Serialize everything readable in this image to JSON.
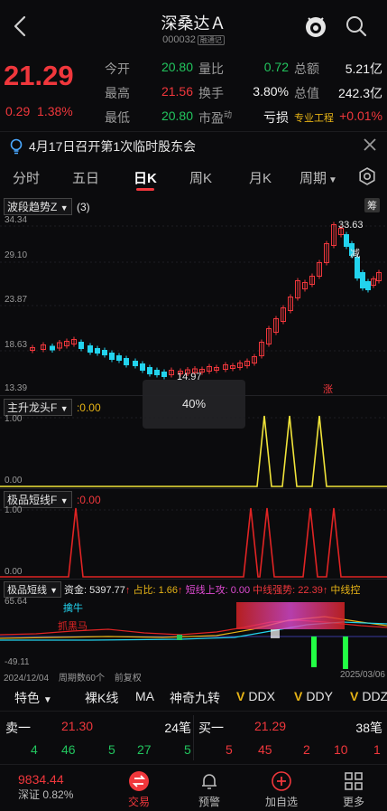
{
  "header": {
    "title": "深桑达Ａ",
    "code": "000032",
    "code_tag": "融通记"
  },
  "quote": {
    "price": "21.29",
    "change": "0.29",
    "change_pct": "1.38%",
    "fields": [
      {
        "label": "今开",
        "value": "20.80",
        "color": "green"
      },
      {
        "label": "量比",
        "value": "0.72",
        "color": "green"
      },
      {
        "label": "总额",
        "value": "5.21亿",
        "color": "white"
      },
      {
        "label": "最高",
        "value": "21.56",
        "color": "red"
      },
      {
        "label": "换手",
        "value": "3.80%",
        "color": "white"
      },
      {
        "label": "总值",
        "value": "242.3亿",
        "color": "white"
      },
      {
        "label": "最低",
        "value": "20.80",
        "color": "green"
      },
      {
        "label": "市盈",
        "value": "亏损",
        "color": "white",
        "label_sup": "动"
      },
      {
        "label": "专业工程",
        "value": "+0.01%",
        "color": "red"
      }
    ]
  },
  "notice": {
    "text": "4月17日召开第1次临时股东会"
  },
  "tabs": [
    "分时",
    "五日",
    "日K",
    "周K",
    "月K",
    "周期"
  ],
  "main_chart": {
    "indicator": "波段趋势Z",
    "param": "(3)",
    "chip_label": "筹",
    "y_labels": [
      "34.34",
      "29.10",
      "23.87",
      "18.63",
      "13.39"
    ],
    "high_label": "33.63",
    "low_label": "14.97",
    "overlay_pct": "40%",
    "mark_jian": "减",
    "mark_zhang": "涨"
  },
  "panel2": {
    "indicator": "主升龙头F",
    "value": ":0.00",
    "y_top": "1.00",
    "y_bottom": "0.00"
  },
  "panel3": {
    "indicator": "极品短线F",
    "value": ":0.00",
    "y_top": "1.00",
    "y_bottom": "0.00"
  },
  "panel4": {
    "indicator": "极品短线",
    "fund": "资金: 5397.77",
    "ratio": "占比: 1.66",
    "short_up": "短线上攻: 0.00",
    "mid_strength": "中线强势: 22.39",
    "mid_ctrl": "中线控",
    "y_top": "65.64",
    "y_bottom": "-49.11",
    "start_date": "2024/12/04",
    "period_count": "周期数60个",
    "adjust": "前复权",
    "end_date": "2025/03/06",
    "tag_qinniu": "擒牛",
    "tag_zhuahei": "抓黑马"
  },
  "indicator_row": [
    {
      "label": "特色",
      "has_arrow": true
    },
    {
      "label": "裸K线"
    },
    {
      "label": "MA"
    },
    {
      "label": "神奇九转"
    },
    {
      "label": "DDX",
      "v": true
    },
    {
      "label": "DDY",
      "v": true
    },
    {
      "label": "DDZ",
      "v": true
    }
  ],
  "order_book": {
    "sell_label": "卖一",
    "sell_price": "21.30",
    "sell_qty": "24笔",
    "buy_label": "买一",
    "buy_price": "21.29",
    "buy_qty": "38笔",
    "sell_detail": [
      "4",
      "46",
      "5",
      "27",
      "5"
    ],
    "buy_detail": [
      "5",
      "45",
      "2",
      "10",
      "1"
    ]
  },
  "bottom_bar": {
    "index_value": "9834.44",
    "index_label": "深证 0.82%",
    "items": [
      "交易",
      "预警",
      "加自选",
      "更多"
    ]
  },
  "colors": {
    "up": "#f0373c",
    "down": "#22c55e",
    "accent_yellow": "#e7b416",
    "line_red": "#e02424",
    "line_yellow": "#f0e33a",
    "cyan": "#22d3ee"
  }
}
